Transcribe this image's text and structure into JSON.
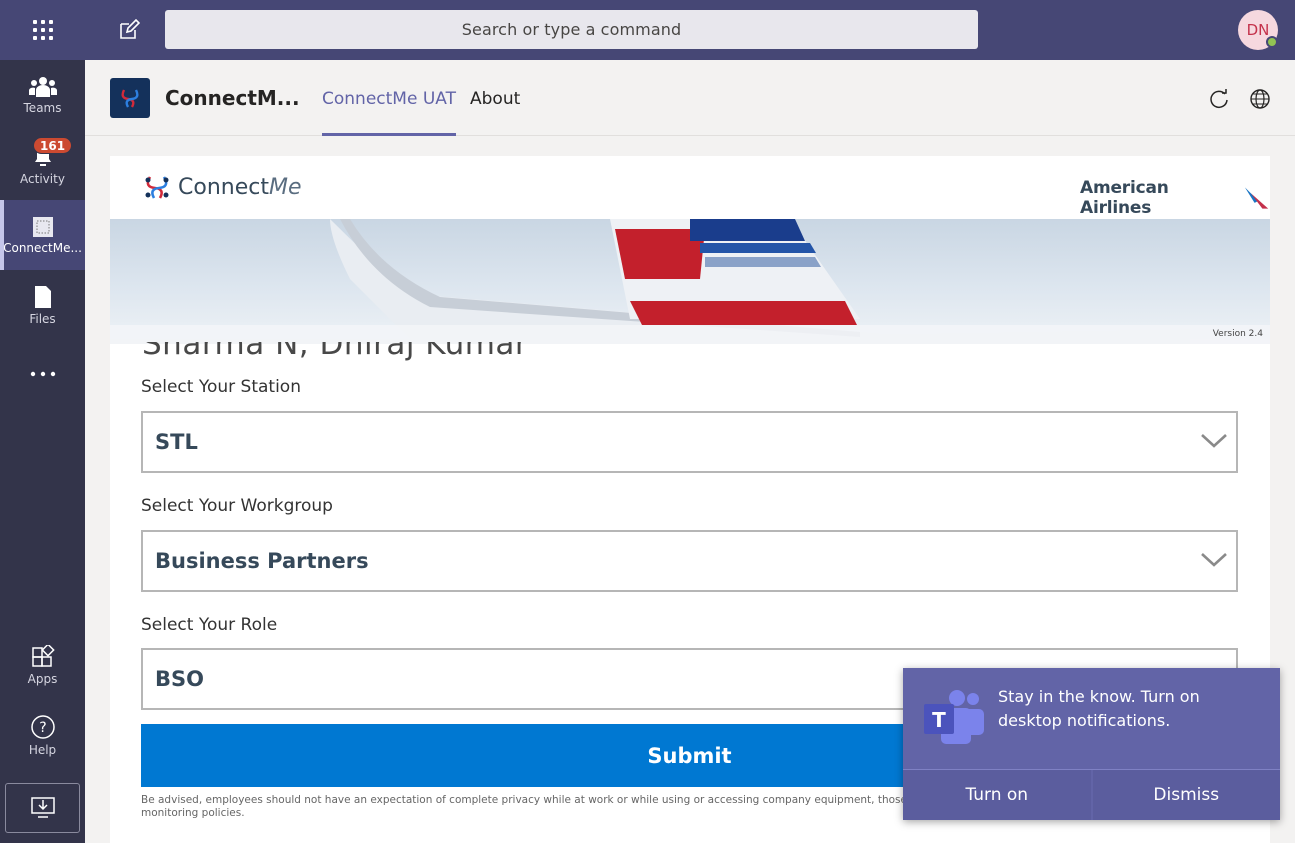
{
  "topbar": {
    "search_placeholder": "Search or type a command",
    "avatar_initials": "DN"
  },
  "rail": {
    "items": [
      {
        "label": "Teams",
        "icon": "teams-icon"
      },
      {
        "label": "Activity",
        "icon": "bell-icon",
        "badge": "161"
      },
      {
        "label": "ConnectMe...",
        "icon": "app-icon",
        "active": true
      },
      {
        "label": "Files",
        "icon": "file-icon"
      },
      {
        "label": "...",
        "icon": "more-icon"
      },
      {
        "label": "Apps",
        "icon": "apps-icon"
      },
      {
        "label": "Help",
        "icon": "help-icon"
      }
    ]
  },
  "app_header": {
    "app_name": "ConnectM...",
    "tabs": [
      {
        "label": "ConnectMe UAT",
        "active": true
      },
      {
        "label": "About",
        "active": false
      }
    ]
  },
  "page": {
    "brand_prefix": "Connect",
    "brand_suffix": "Me",
    "airline_name": "American Airlines",
    "version": "Version 2.4",
    "user_name": "Sharma N, Dhiraj Kumar",
    "station_label": "Select Your Station",
    "station_value": "STL",
    "workgroup_label": "Select Your Workgroup",
    "workgroup_value": "Business Partners",
    "role_label": "Select Your Role",
    "role_value": "BSO",
    "submit_label": "Submit",
    "disclaimer": "Be advised, employees should not have an expectation of complete privacy while at work or while using or accessing company equipment, those systems may be accessed at any time in accordance with our monitoring policies."
  },
  "toast": {
    "message": "Stay in the know. Turn on desktop notifications.",
    "turn_on_label": "Turn on",
    "dismiss_label": "Dismiss"
  },
  "colors": {
    "teams_purple": "#6264a7",
    "rail_bg": "#33344a",
    "topbar_bg": "#464775",
    "submit_blue": "#0078d2"
  }
}
